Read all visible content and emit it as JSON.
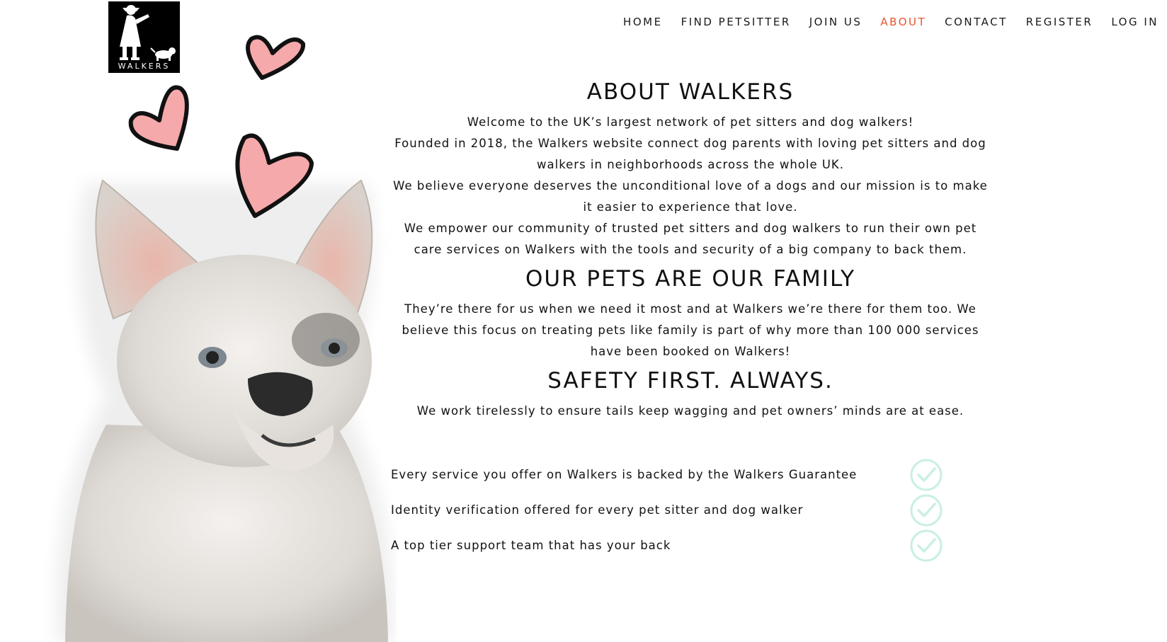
{
  "logo": {
    "text": "WALKERS"
  },
  "nav": {
    "items": [
      {
        "label": "HOME",
        "active": false
      },
      {
        "label": "FIND PETSITTER",
        "active": false
      },
      {
        "label": "JOIN US",
        "active": false
      },
      {
        "label": "ABOUT",
        "active": true
      },
      {
        "label": "CONTACT",
        "active": false
      },
      {
        "label": "REGISTER",
        "active": false
      },
      {
        "label": "LOG IN",
        "active": false
      }
    ],
    "active_color": "#e8532c"
  },
  "about": {
    "title": "ABOUT WALKERS",
    "paragraphs": [
      "Welcome to the UK’s largest network of pet sitters and dog walkers!",
      "Founded in 2018, the Walkers website connect dog parents with loving pet sitters and dog walkers in neighborhoods across the whole UK.",
      "We believe everyone deserves the unconditional love of a dogs and our mission is to make it easier to experience that love.",
      "We empower our community of trusted pet sitters and dog walkers to run their own pet care services on Walkers with the tools and security of a big company to back them."
    ]
  },
  "family": {
    "title": "OUR PETS ARE OUR FAMILY",
    "text": "They’re there for us when we need it most and at Walkers we’re there for them too. We believe this focus on treating pets like family is part of why more than 100 000 services have been booked on Walkers!"
  },
  "safety": {
    "title": "SAFETY FIRST. ALWAYS.",
    "text": "We work tirelessly to ensure tails keep wagging and pet owners’ minds are at ease.",
    "features": [
      "Every service you offer on Walkers is backed by the Walkers Guarantee",
      "Identity verification offered for every pet sitter and dog walker",
      "A top tier support team that has your back"
    ]
  },
  "icons": {
    "hearts": "heart-icon",
    "check": "check-circle-icon",
    "check_color": "#c9f0e0"
  }
}
